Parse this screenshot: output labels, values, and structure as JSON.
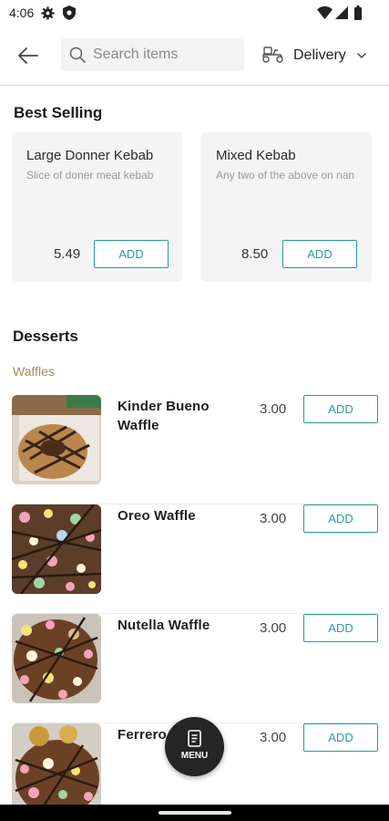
{
  "status_bar": {
    "time": "4:06"
  },
  "header": {
    "search": {
      "placeholder": "Search items",
      "value": ""
    },
    "order_mode": "Delivery"
  },
  "best_selling": {
    "title": "Best Selling",
    "items": [
      {
        "name": "Large Donner Kebab",
        "description": "Slice of doner meat kebab",
        "price": "5.49",
        "add_label": "ADD"
      },
      {
        "name": "Mixed Kebab",
        "description": "Any two of the above on nan",
        "price": "8.50",
        "add_label": "ADD"
      }
    ]
  },
  "desserts": {
    "title": "Desserts",
    "subcategory": "Waffles",
    "items": [
      {
        "name": "Kinder Bueno Waffle",
        "price": "3.00",
        "add_label": "ADD"
      },
      {
        "name": "Oreo Waffle",
        "price": "3.00",
        "add_label": "ADD"
      },
      {
        "name": "Nutella Waffle",
        "price": "3.00",
        "add_label": "ADD"
      },
      {
        "name": "Ferrero",
        "price": "3.00",
        "add_label": "ADD"
      }
    ]
  },
  "menu_button": {
    "label": "MENU"
  },
  "colors": {
    "accent": "#2a9aa3",
    "subcategory": "#a58a62",
    "card_bg": "#f4f4f4"
  }
}
